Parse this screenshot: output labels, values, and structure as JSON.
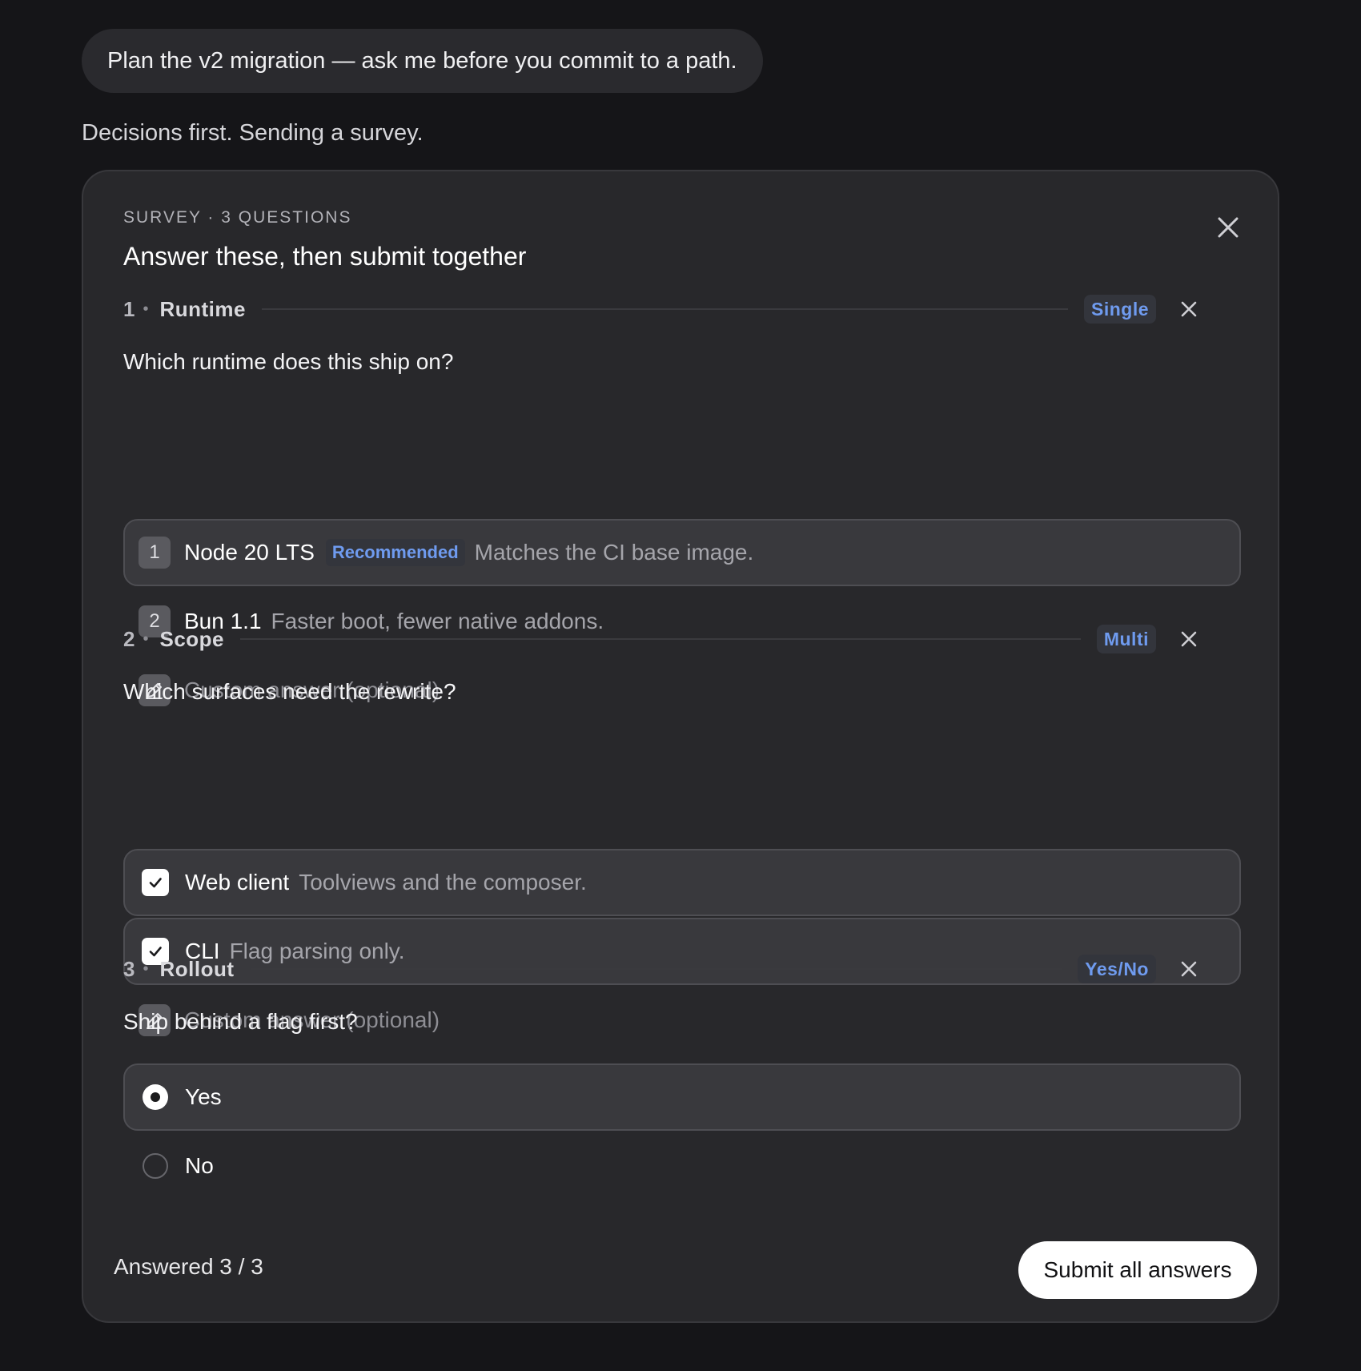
{
  "chat": {
    "user_message": "Plan the v2 migration — ask me before you commit to a path.",
    "assistant_message": "Decisions first. Sending a survey."
  },
  "survey": {
    "eyebrow": "SURVEY · 3 QUESTIONS",
    "title": "Answer these, then submit together",
    "close_icon": "close-icon",
    "sections": [
      {
        "number": "1",
        "name": "Runtime",
        "type_badge": "Single",
        "question": "Which runtime does this ship on?",
        "options": [
          {
            "index": "1",
            "label": "Node 20 LTS",
            "tag": "Recommended",
            "description": "Matches the CI base image.",
            "selected": true
          },
          {
            "index": "2",
            "label": "Bun 1.1",
            "description": "Faster boot, fewer native addons.",
            "selected": false
          }
        ],
        "custom_placeholder": "Custom answer (optional)"
      },
      {
        "number": "2",
        "name": "Scope",
        "type_badge": "Multi",
        "question": "Which surfaces need the rewrite?",
        "options": [
          {
            "label": "Web client",
            "description": "Toolviews and the composer.",
            "checked": true
          },
          {
            "label": "CLI",
            "description": "Flag parsing only.",
            "checked": true
          }
        ],
        "custom_placeholder": "Custom answer (optional)"
      },
      {
        "number": "3",
        "name": "Rollout",
        "type_badge": "Yes/No",
        "question": "Ship behind a flag first?",
        "options": [
          {
            "label": "Yes",
            "selected": true
          },
          {
            "label": "No",
            "selected": false
          }
        ]
      }
    ],
    "footer": {
      "answered": "Answered 3 / 3",
      "submit_label": "Submit all answers"
    }
  },
  "colors": {
    "page_bg": "#151518",
    "card_bg": "#28282b",
    "accent_blue": "#6f9bef",
    "selected_bg": "#39393d"
  }
}
